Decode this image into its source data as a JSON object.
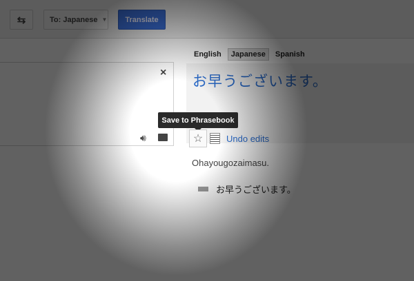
{
  "toolbar": {
    "swap_icon": "swap-arrows-icon",
    "to_language": "To: Japanese",
    "translate_label": "Translate"
  },
  "source": {
    "clear_icon": "×",
    "speaker_icon": "speaker-icon",
    "comment_icon": "comment-icon"
  },
  "target_tabs": [
    {
      "label": "English"
    },
    {
      "label": "Japanese",
      "selected": true
    },
    {
      "label": "Spanish"
    }
  ],
  "output": {
    "text": "お早うございます。",
    "tooltip": "Save to Phrasebook",
    "undo_label": "Undo edits",
    "romanization": "Ohayougozaimasu.",
    "dictionary_entry": "お早うございます。"
  },
  "colors": {
    "accent": "#2a6ac8",
    "button": "#3b6fd8"
  }
}
